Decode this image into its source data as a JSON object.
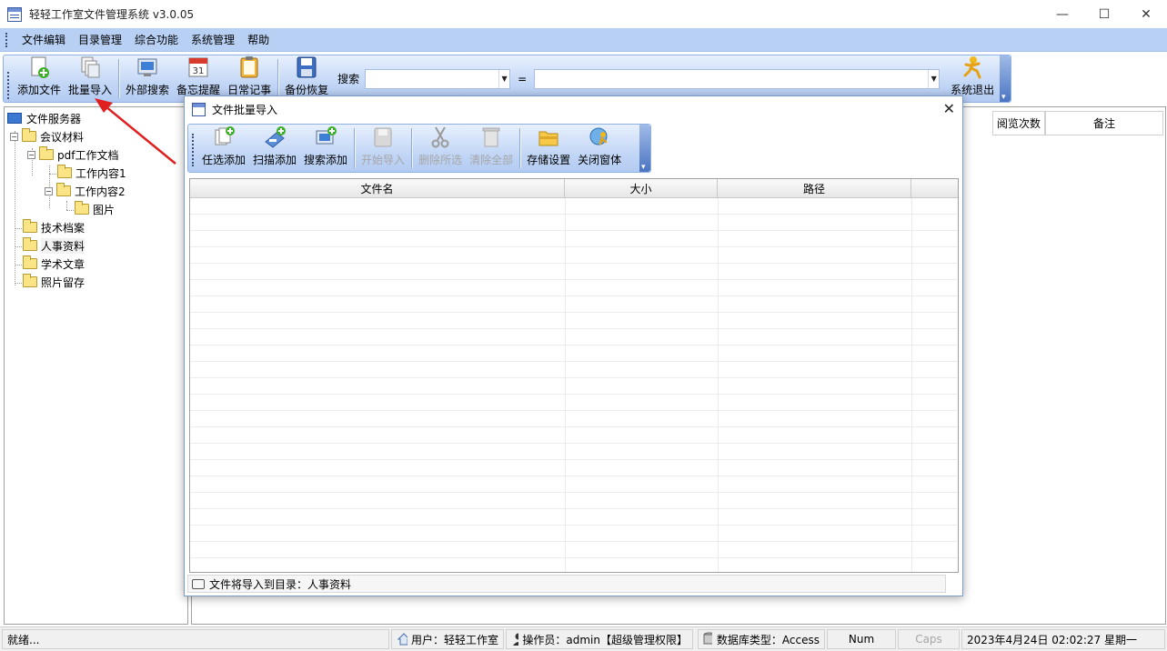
{
  "window": {
    "title": "轻轻工作室文件管理系统 v3.0.05",
    "minimize": "—",
    "maximize": "☐",
    "close": "✕"
  },
  "menu": [
    "文件编辑",
    "目录管理",
    "综合功能",
    "系统管理",
    "帮助"
  ],
  "toolbar": {
    "buttons": [
      "添加文件",
      "批量导入",
      "外部搜索",
      "备忘提醒",
      "日常记事",
      "备份恢复"
    ],
    "search_label": "搜索",
    "search_field_value": "",
    "equals": "=",
    "search_value": "",
    "exit": "系统退出",
    "calendar_day": "31"
  },
  "tree": {
    "root": "文件服务器",
    "nodes": [
      "会议材料",
      "pdf工作文档",
      "工作内容1",
      "工作内容2",
      "图片",
      "技术档案",
      "人事资料",
      "学术文章",
      "照片留存"
    ],
    "expanders": {
      "open": "−"
    }
  },
  "main_list": {
    "columns": [
      "阅览次数",
      "备注"
    ]
  },
  "dialog": {
    "title": "文件批量导入",
    "close": "✕",
    "toolbar": {
      "buttons": [
        "任选添加",
        "扫描添加",
        "搜索添加",
        "开始导入",
        "删除所选",
        "清除全部",
        "存储设置",
        "关闭窗体"
      ],
      "disabled": [
        "开始导入",
        "删除所选",
        "清除全部"
      ]
    },
    "grid": {
      "columns": [
        "文件名",
        "大小",
        "路径"
      ]
    },
    "status": "文件将导入到目录：人事资料"
  },
  "statusbar": {
    "ready": "就绪...",
    "user": "用户：轻轻工作室",
    "operator": "操作员：admin【超级管理权限】",
    "db": "数据库类型：Access",
    "num": "Num",
    "caps": "Caps",
    "datetime": "2023年4月24日 02:02:27 星期一"
  },
  "colors": {
    "accent": "#b8d0f4",
    "arrow": "#e02020"
  }
}
